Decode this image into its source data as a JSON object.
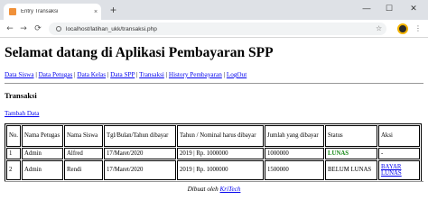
{
  "browser": {
    "tab_title": "Entry Transaksi",
    "tab_close": "×",
    "new_tab": "+",
    "url": "localhost/latihan_ukk/transaksi.php",
    "back": "←",
    "forward": "→",
    "reload": "⟳",
    "star": "☆",
    "menu": "⋮",
    "minimize": "—",
    "maximize": "☐",
    "close": "✕"
  },
  "page": {
    "title": "Selamat datang di Aplikasi Pembayaran SPP",
    "nav": [
      "Data Siswa",
      "Data Petugas",
      "Data Kelas",
      "Data SPP",
      "Transaksi",
      "History Pembayaran",
      "LogOut"
    ],
    "nav_separator": "|",
    "section_title": "Transaksi",
    "add_link": "Tambah Data"
  },
  "table": {
    "headers": [
      "No.",
      "Nama Petugas",
      "Nama Siswa",
      "Tgl/Bulan/Tahun dibayar",
      "Tahun / Nominal harus dibayar",
      "Jumlah yang dibayar",
      "Status",
      "Aksi"
    ],
    "rows": [
      [
        "1",
        "Admin",
        "Alfred",
        "17/Maret/2020",
        "2019 | Rp. 1000000",
        "1000000",
        "LUNAS",
        "-"
      ],
      [
        "2",
        "Admin",
        "Rendi",
        "17/Maret/2020",
        "2019 | Rp. 1000000",
        "1500000",
        "BELUM LUNAS",
        "BAYAR LUNAS"
      ]
    ]
  },
  "footer": {
    "prefix": "Dibuat oleh",
    "author": "KriTech"
  },
  "colors": {
    "lunas": "#1a8a1a",
    "link": "#0000ee",
    "tab_favicon": "#f0913a"
  }
}
